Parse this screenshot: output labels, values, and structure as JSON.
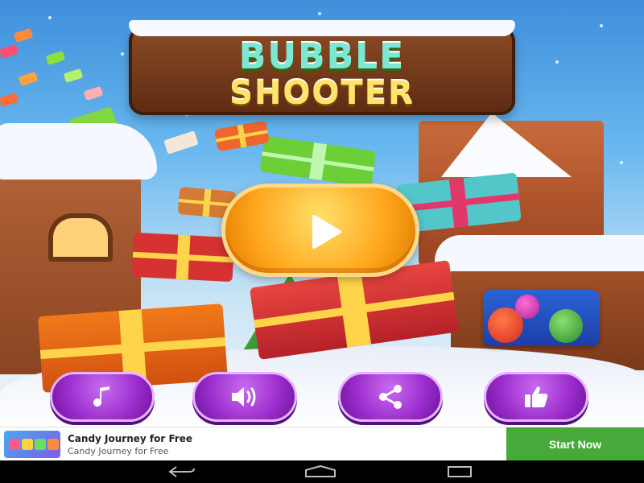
{
  "title": {
    "line1": "BUBBLE",
    "line2": "SHOOTER"
  },
  "main": {
    "play_icon": "play-icon",
    "promo_icon": "fruit-game-icon"
  },
  "buttons": [
    {
      "name": "music",
      "icon": "music-note-icon"
    },
    {
      "name": "sound",
      "icon": "speaker-icon"
    },
    {
      "name": "share",
      "icon": "share-icon"
    },
    {
      "name": "like",
      "icon": "thumbs-up-icon"
    }
  ],
  "ad": {
    "title": "Candy Journey for Free",
    "subtitle": "Candy Journey for Free",
    "cta": "Start Now",
    "icon": "candy-game-icon"
  },
  "nav": {
    "back_icon": "back-icon",
    "home_icon": "home-icon",
    "recent_icon": "recent-apps-icon"
  },
  "colors": {
    "cta_green": "#46a93a",
    "button_purple": "#9b2ccc",
    "play_orange": "#ffa61c"
  }
}
